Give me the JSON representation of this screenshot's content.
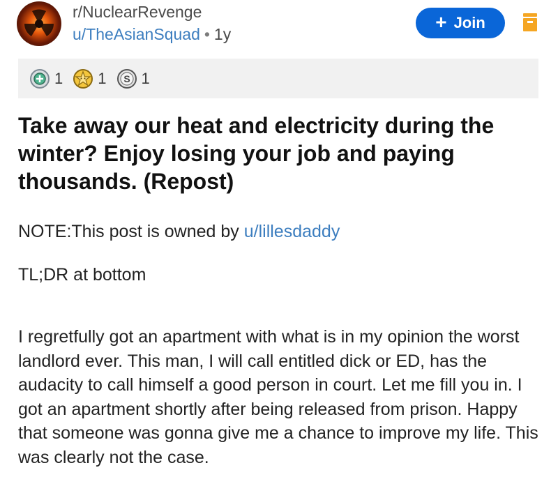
{
  "post": {
    "subreddit": "r/NuclearRevenge",
    "author": "u/TheAsianSquad",
    "separator": "•",
    "age": "1y",
    "join_label": "Join",
    "join_plus": "+",
    "awards": [
      {
        "icon": "helpful-award-icon",
        "count": "1"
      },
      {
        "icon": "wholesome-award-icon",
        "count": "1"
      },
      {
        "icon": "silver-award-icon",
        "count": "1"
      }
    ],
    "title": "Take away our heat and electricity during the winter? Enjoy losing your job and paying thousands. (Repost)",
    "note_prefix": "NOTE:This post is owned by ",
    "note_link": "u/lillesdaddy",
    "tldr": "TL;DR at bottom",
    "body": "I regretfully got an apartment with what is in my opinion the worst landlord ever. This man, I will call entitled dick or ED, has the audacity to call himself a good person in court. Let me fill you in. I got an apartment shortly after being released from prison. Happy that someone was gonna give me a chance to improve my life. This was clearly not the case."
  },
  "colors": {
    "join_button": "#0a66d8",
    "link": "#3d7ebf",
    "save_icon": "#f5a623",
    "awards_bg": "#f1f1f1"
  }
}
